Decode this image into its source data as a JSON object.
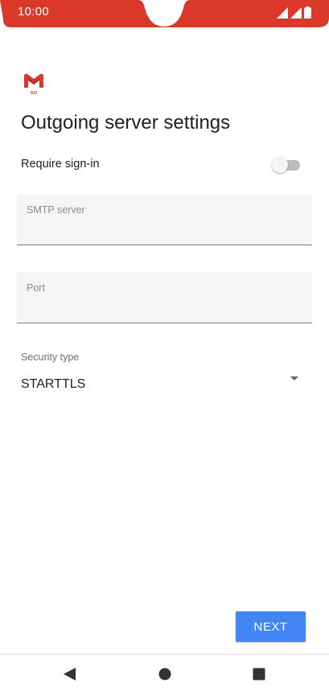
{
  "status_bar": {
    "time": "10:00",
    "background_color": "#d9382b"
  },
  "app": {
    "logo_icon": "gmail-go-logo",
    "logo_text": "GO"
  },
  "page": {
    "title": "Outgoing server settings"
  },
  "require_signin": {
    "label": "Require sign-in",
    "enabled": false
  },
  "smtp_server": {
    "label": "SMTP server",
    "value": ""
  },
  "port": {
    "label": "Port",
    "value": ""
  },
  "security_type": {
    "label": "Security type",
    "selected": "STARTTLS"
  },
  "actions": {
    "next_label": "NEXT",
    "accent_color": "#4285f4"
  },
  "nav": {
    "back_icon": "back-triangle-icon",
    "home_icon": "home-circle-icon",
    "recents_icon": "recents-square-icon"
  }
}
